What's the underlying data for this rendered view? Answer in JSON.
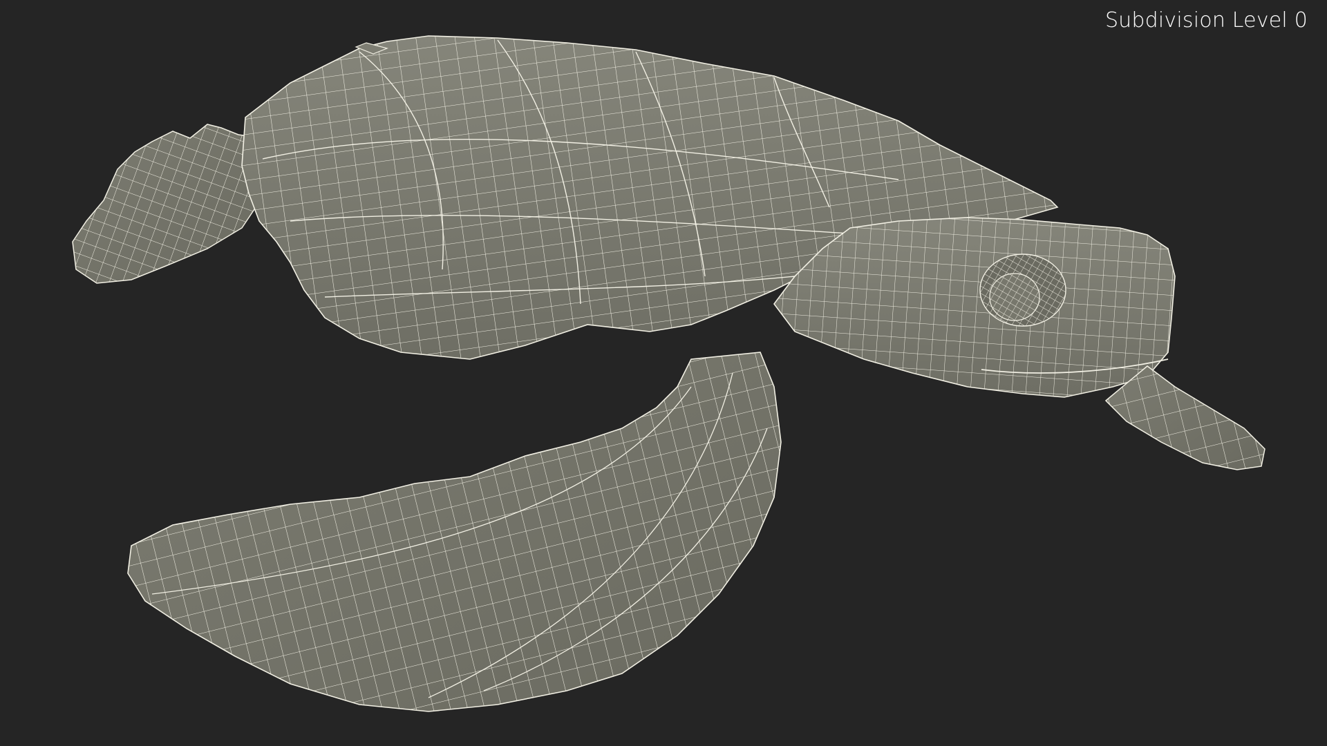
{
  "viewport": {
    "subdivision_label": "Subdivision Level 0",
    "background_color": "#252525",
    "mesh_fill_color": "#7a7a6e",
    "mesh_shade_color": "#66665c",
    "wire_color": "#f2f0e4",
    "subject": "sea-turtle-wireframe"
  }
}
